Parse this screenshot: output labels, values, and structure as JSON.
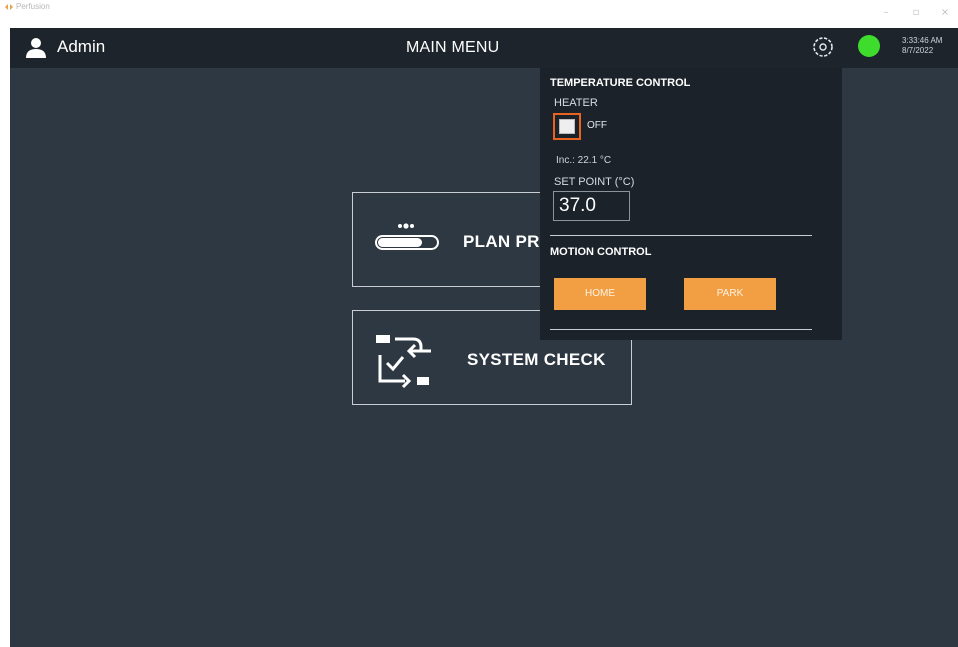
{
  "window": {
    "app_name": "Perfusion",
    "controls": [
      "minimize-icon",
      "maximize-icon",
      "close-icon"
    ]
  },
  "topbar": {
    "user_name": "Admin",
    "page_title": "MAIN MENU",
    "time": "3:33:46 AM",
    "date": "8/7/2022",
    "status_color": "#3ddc2d"
  },
  "menu": {
    "items": [
      {
        "label": "PLAN PR",
        "icon": "sequence-plan-icon"
      },
      {
        "label": "SYSTEM CHECK",
        "icon": "system-check-icon"
      }
    ]
  },
  "temperature_panel": {
    "title": "TEMPERATURE CONTROL",
    "heater_label": "HEATER",
    "heater_state": "OFF",
    "incubator_temp": "Inc.: 22.1 °C",
    "setpoint_label": "SET POINT (°C)",
    "setpoint_value": "37.0"
  },
  "motion_panel": {
    "title": "MOTION CONTROL",
    "home_label": "HOME",
    "park_label": "PARK"
  },
  "colors": {
    "accent_orange": "#f29e42",
    "toggle_border": "#e8641f",
    "background": "#2e3842",
    "topbar": "#1d242b",
    "panel": "#1b2229"
  }
}
